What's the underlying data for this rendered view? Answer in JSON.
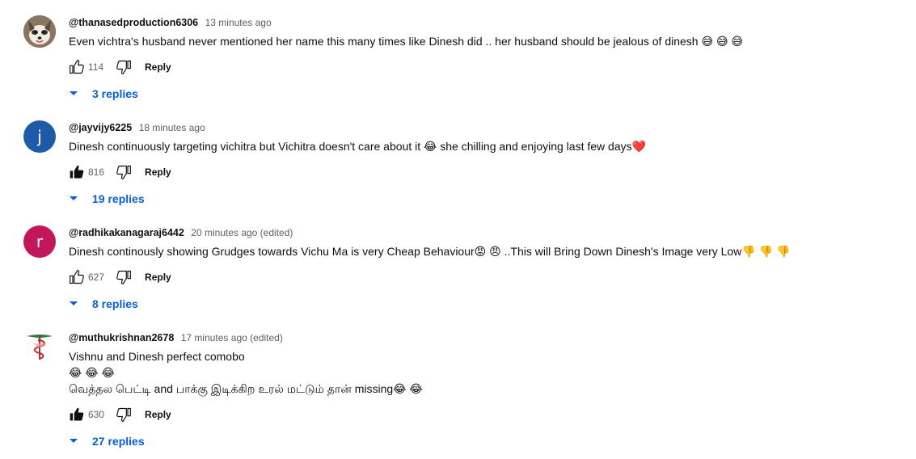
{
  "colors": {
    "link_blue": "#065fd4",
    "meta_gray": "#606060",
    "text": "#0f0f0f",
    "avatar_j": "#1f5aa8",
    "avatar_r": "#c2185b"
  },
  "comments": [
    {
      "author": "@thanasedproduction6306",
      "time": "13 minutes ago",
      "avatar": "dog-photo-avatar",
      "text_lines": [
        "Even vichtra's husband never mentioned her name this many times like Dinesh did .. her husband should be jealous of dinesh 😅 😅 😅"
      ],
      "likes": "114",
      "liked": false,
      "reply_label": "Reply",
      "replies_label": "3 replies"
    },
    {
      "author": "@jayvijy6225",
      "time": "18 minutes ago",
      "avatar": "j",
      "text_lines": [
        "Dinesh continuously targeting vichitra but Vichitra doesn't care about it 😂  she chilling and enjoying last few days❤️"
      ],
      "likes": "816",
      "liked": true,
      "reply_label": "Reply",
      "replies_label": "19 replies"
    },
    {
      "author": "@radhikakanagaraj6442",
      "time": "20 minutes ago (edited)",
      "avatar": "r",
      "text_lines": [
        "Dinesh continously showing Grudges towards Vichu Ma is very Cheap Behaviour😡 😠 ..This will Bring Down Dinesh's Image very Low👎 👎 👎"
      ],
      "likes": "627",
      "liked": false,
      "reply_label": "Reply",
      "replies_label": "8 replies"
    },
    {
      "author": "@muthukrishnan2678",
      "time": "17 minutes ago (edited)",
      "avatar": "caduceus-avatar",
      "text_lines": [
        "Vishnu and Dinesh perfect comobo",
        "😂 😂 😂",
        "வெத்தல பெட்டி and பாக்கு இடிக்கிற உரல் மட்டும் தான் missing😂 😂"
      ],
      "likes": "630",
      "liked": true,
      "reply_label": "Reply",
      "replies_label": "27 replies"
    }
  ]
}
